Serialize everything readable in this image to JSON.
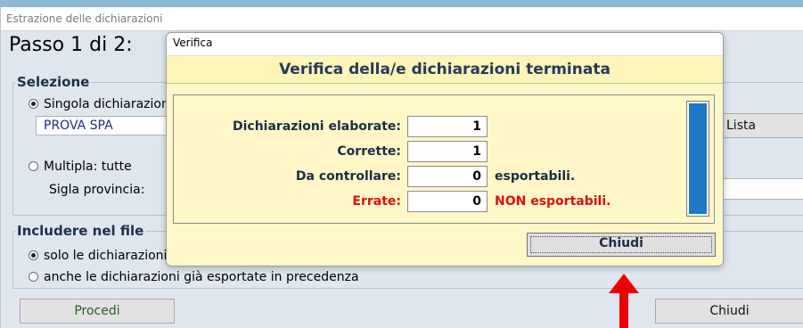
{
  "background_window": {
    "title": "Estrazione delle dichiarazioni",
    "step_title": "Passo 1 di 2:",
    "selection_group": {
      "legend": "Selezione",
      "single_option": "Singola dichiarazione",
      "single_value": "PROVA SPA",
      "list_button": "Lista",
      "multiple_option": "Multipla: tutte",
      "province_label": "Sigla provincia:"
    },
    "include_group": {
      "legend": "Includere nel file",
      "option_only": "solo le dichiarazioni",
      "option_also": "anche le dichiarazioni già esportate in precedenza"
    },
    "proceed_button": "Procedi",
    "close_button": "Chiudi"
  },
  "dialog": {
    "title": "Verifica",
    "header": "Verifica della/e dichiarazioni terminata",
    "rows": [
      {
        "label": "Dichiarazioni elaborate:",
        "value": "1",
        "note": ""
      },
      {
        "label": "Corrette:",
        "value": "1",
        "note": ""
      },
      {
        "label": "Da controllare:",
        "value": "0",
        "note": "esportabili."
      },
      {
        "label": "Errate:",
        "value": "0",
        "note": "NON esportabili."
      }
    ],
    "progress": 1.0,
    "close_button": "Chiudi"
  },
  "colors": {
    "dialog_bg": "#fff7c8",
    "error_red": "#e01010",
    "progress_blue": "#1f77c9",
    "arrow_red": "#ee0000"
  }
}
